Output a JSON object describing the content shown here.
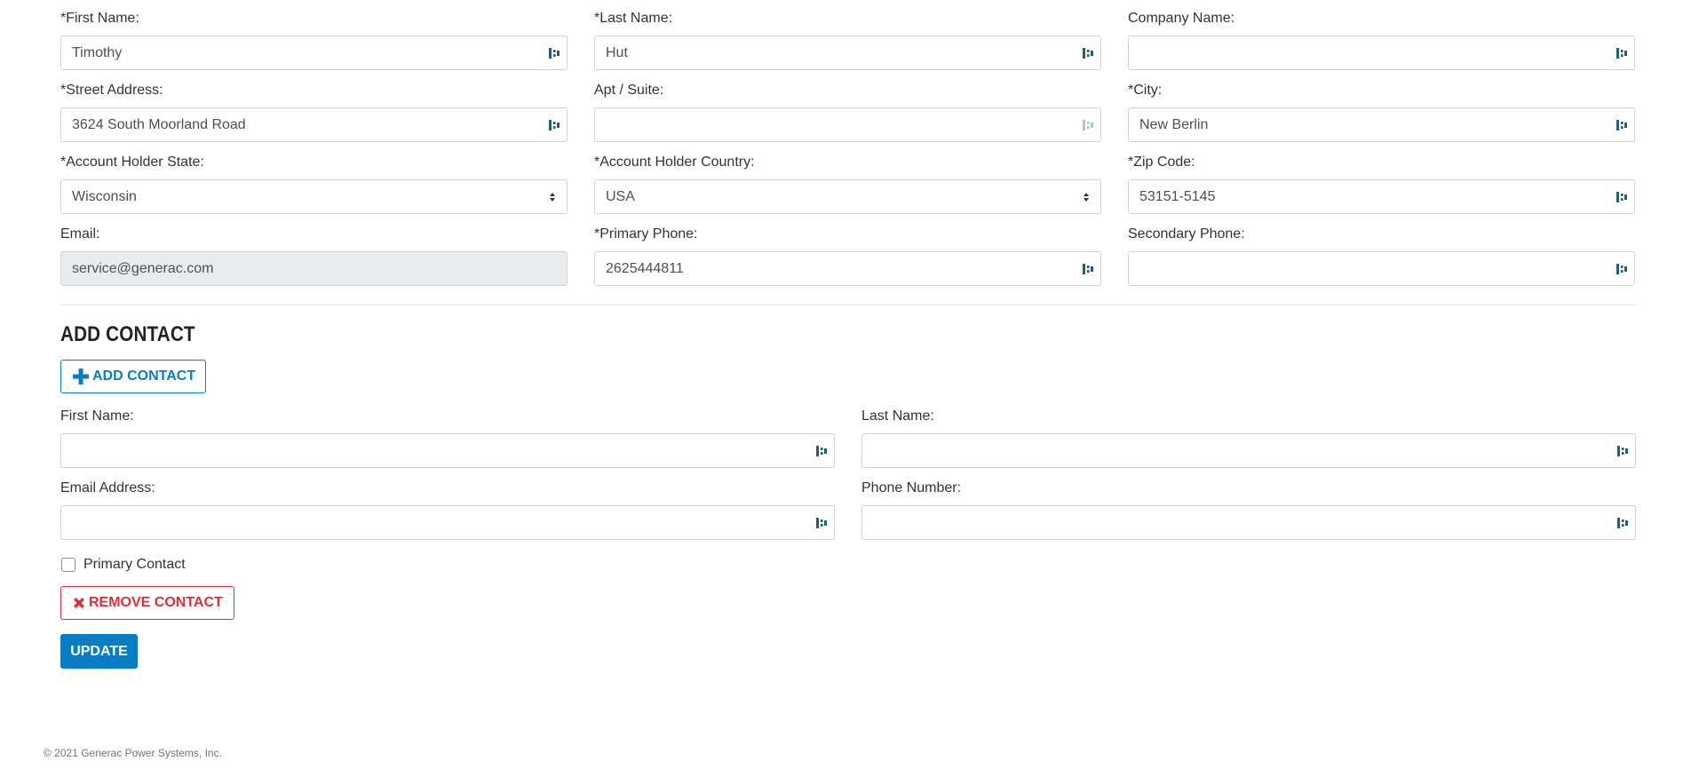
{
  "account": {
    "first_name": {
      "label": "*First Name:",
      "value": "Timothy"
    },
    "last_name": {
      "label": "*Last Name:",
      "value": "Hut"
    },
    "company_name": {
      "label": "Company Name:",
      "value": ""
    },
    "street_address": {
      "label": "*Street Address:",
      "value": "3624 South Moorland Road"
    },
    "apt_suite": {
      "label": "Apt / Suite:",
      "value": ""
    },
    "city": {
      "label": "*City:",
      "value": "New Berlin"
    },
    "state": {
      "label": "*Account Holder State:",
      "selected": "Wisconsin"
    },
    "country": {
      "label": "*Account Holder Country:",
      "selected": "USA"
    },
    "zip": {
      "label": "*Zip Code:",
      "value": "53151-5145"
    },
    "email": {
      "label": "Email:",
      "value": "service@generac.com"
    },
    "primary_phone": {
      "label": "*Primary Phone:",
      "value": "2625444811"
    },
    "secondary_phone": {
      "label": "Secondary Phone:",
      "value": ""
    }
  },
  "add_contact": {
    "section_title": "ADD CONTACT",
    "add_button_label": "ADD CONTACT",
    "first_name_label": "First Name:",
    "last_name_label": "Last Name:",
    "email_label": "Email Address:",
    "phone_label": "Phone Number:",
    "primary_contact_label": "Primary Contact",
    "primary_contact_checked": false,
    "remove_button_label": "REMOVE CONTACT"
  },
  "actions": {
    "update_label": "UPDATE"
  },
  "footer": {
    "copyright": "© 2021 Generac Power Systems, Inc."
  },
  "colors": {
    "primary": "#0a7cc4",
    "danger": "#d9303d",
    "icon": "#1f5f78"
  },
  "icons": {
    "field_icon": "password-manager-icon",
    "select_icon": "select-arrows-icon",
    "add_icon": "plus-icon",
    "remove_icon": "close-icon"
  }
}
